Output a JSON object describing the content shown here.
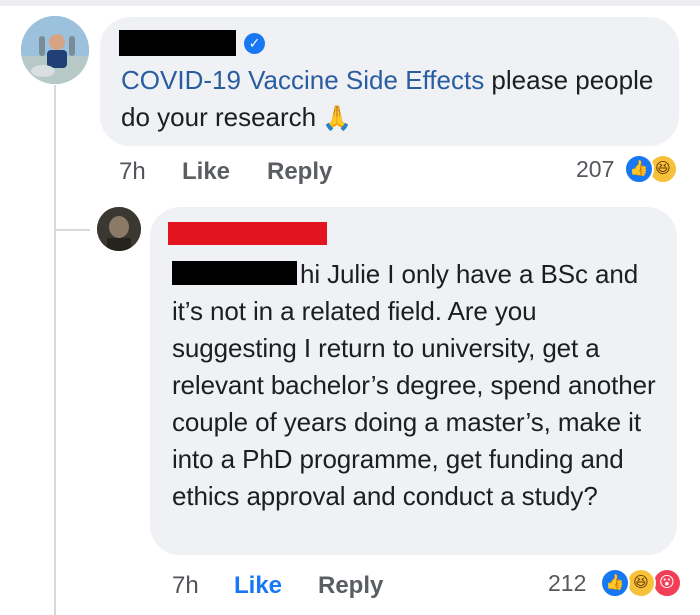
{
  "comment1": {
    "text_link": "COVID-19 Vaccine Side Effects",
    "text_rest": " please people do your research",
    "emoji": "🙏",
    "time": "7h",
    "like_label": "Like",
    "reply_label": "Reply",
    "reaction_count": "207",
    "reactions": [
      "like-reaction-icon",
      "haha-reaction-icon"
    ],
    "verified_icon": "✓"
  },
  "comment2": {
    "text_first_line": "hi Julie I only have a BSc",
    "text_rest": "and it’s not in a related field. Are you suggesting I return to university, get a relevant bachelor’s degree, spend another couple of years doing a master’s, make it into a PhD programme, get funding and ethics approval and conduct a study?",
    "time": "7h",
    "like_label": "Like",
    "reply_label": "Reply",
    "reaction_count": "212",
    "reactions": [
      "like-reaction-icon",
      "haha-reaction-icon",
      "wow-reaction-icon"
    ]
  },
  "colors": {
    "bubble_bg": "#eff1f5",
    "link": "#2a5d9f",
    "like_blue": "#1877f2",
    "redaction_black": "#000000",
    "redaction_red": "#e4141f"
  }
}
